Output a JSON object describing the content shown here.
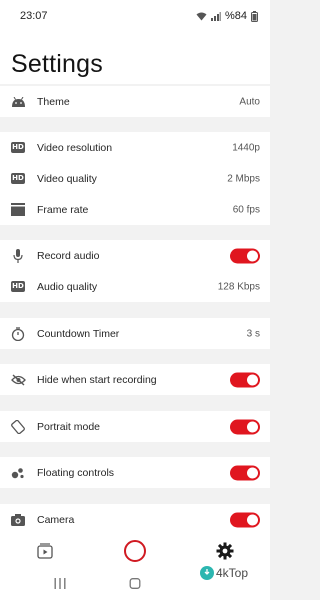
{
  "status_bar": {
    "time": "23:07",
    "battery": "%84"
  },
  "header": {
    "title": "Settings"
  },
  "groups": [
    {
      "rows": [
        {
          "label": "Theme",
          "value": "Auto",
          "icon": "android-icon"
        }
      ]
    },
    {
      "rows": [
        {
          "label": "Video resolution",
          "value": "1440p",
          "icon": "hd-icon"
        },
        {
          "label": "Video quality",
          "value": "2 Mbps",
          "icon": "hd-icon"
        },
        {
          "label": "Frame rate",
          "value": "60 fps",
          "icon": "frame-rate-icon"
        }
      ]
    },
    {
      "rows": [
        {
          "label": "Record audio",
          "toggle": true,
          "icon": "microphone-icon"
        },
        {
          "label": "Audio quality",
          "value": "128 Kbps",
          "icon": "hd-icon"
        }
      ]
    },
    {
      "rows": [
        {
          "label": "Countdown Timer",
          "value": "3 s",
          "icon": "timer-icon"
        }
      ]
    },
    {
      "rows": [
        {
          "label": "Hide when start recording",
          "toggle": true,
          "icon": "eye-off-icon"
        }
      ]
    },
    {
      "rows": [
        {
          "label": "Portrait mode",
          "toggle": true,
          "icon": "screen-rotation-icon"
        }
      ]
    },
    {
      "rows": [
        {
          "label": "Floating controls",
          "toggle": true,
          "icon": "bubbles-icon"
        }
      ]
    },
    {
      "rows": [
        {
          "label": "Camera",
          "toggle": true,
          "icon": "camera-icon"
        }
      ]
    }
  ],
  "hd_badge_text": "HD",
  "bottom_nav": {
    "items": [
      "videos-icon",
      "record-button",
      "settings-gear-icon"
    ]
  },
  "watermark": {
    "text": "4kTop"
  },
  "colors": {
    "accent": "#e0161f",
    "background": "#f2f2f2",
    "surface": "#ffffff"
  }
}
